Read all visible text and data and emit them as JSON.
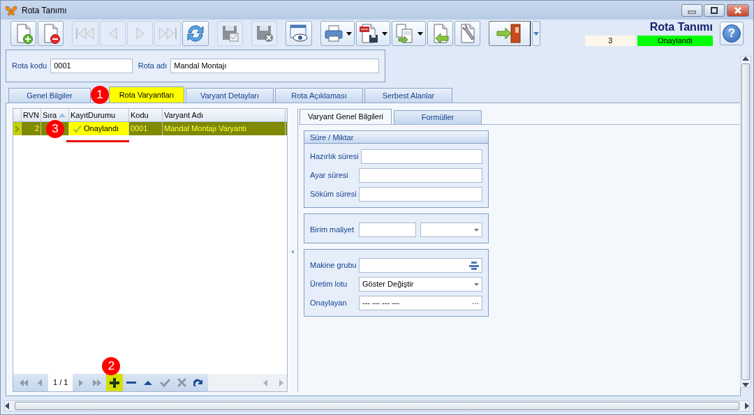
{
  "window": {
    "title": "Rota Tanımı"
  },
  "toolbar": [
    {
      "kind": "new",
      "disabled": false,
      "dropdown": false
    },
    {
      "kind": "delete",
      "disabled": false,
      "dropdown": false
    },
    {
      "kind": "first",
      "disabled": true,
      "dropdown": false
    },
    {
      "kind": "prev",
      "disabled": true,
      "dropdown": false
    },
    {
      "kind": "next",
      "disabled": true,
      "dropdown": false
    },
    {
      "kind": "last",
      "disabled": true,
      "dropdown": false
    },
    {
      "kind": "refresh",
      "disabled": false,
      "dropdown": false
    },
    {
      "kind": "save",
      "disabled": true,
      "dropdown": false
    },
    {
      "kind": "cancel",
      "disabled": true,
      "dropdown": false
    },
    {
      "kind": "preview",
      "disabled": false,
      "dropdown": false
    },
    {
      "kind": "print",
      "disabled": false,
      "dropdown": true
    },
    {
      "kind": "pdf",
      "disabled": false,
      "dropdown": true
    },
    {
      "kind": "copy",
      "disabled": false,
      "dropdown": true
    },
    {
      "kind": "import",
      "disabled": false,
      "dropdown": false
    },
    {
      "kind": "tools",
      "disabled": false,
      "dropdown": false
    },
    {
      "kind": "exit",
      "disabled": false,
      "dropdown": true
    }
  ],
  "header": {
    "title": "Rota Tanımı",
    "record_no": "3",
    "status": "Onaylandı",
    "help": "?"
  },
  "form": [
    {
      "label": "Rota kodu",
      "value": "0001"
    },
    {
      "label": "Rota adı",
      "value": "Mandal Montajı"
    }
  ],
  "tabs": [
    {
      "label": "Genel Bilgiler",
      "selected": false,
      "highlighted": false
    },
    {
      "label": "Rota Varyantları",
      "selected": true,
      "highlighted": true,
      "callout": "1"
    },
    {
      "label": "Varyant Detayları",
      "selected": false,
      "highlighted": false
    },
    {
      "label": "Rota Açıklaması",
      "selected": false,
      "highlighted": false
    },
    {
      "label": "Serbest Alanlar",
      "selected": false,
      "highlighted": false
    }
  ],
  "grid": {
    "columns": [
      "RVN",
      "Sıra",
      "KayıtDurumu",
      "Kodu",
      "Varyant Adı"
    ],
    "rows": [
      {
        "selected": true,
        "callout": "3",
        "cells": [
          "2",
          "",
          "Onaylandı",
          "0001",
          "Mandal Montajı Varyantı"
        ],
        "status_highlighted": true,
        "status_underlined": true
      }
    ]
  },
  "navigator": {
    "page": "1 / 1",
    "buttons": [
      {
        "kind": "first",
        "disabled": true,
        "highlighted": false
      },
      {
        "kind": "prev",
        "disabled": true,
        "highlighted": false
      },
      {
        "kind": "next",
        "disabled": true,
        "highlighted": false
      },
      {
        "kind": "last",
        "disabled": true,
        "highlighted": false
      },
      {
        "kind": "add",
        "disabled": false,
        "highlighted": true,
        "callout": "2"
      },
      {
        "kind": "remove",
        "disabled": false,
        "highlighted": false
      },
      {
        "kind": "up",
        "disabled": false,
        "highlighted": false
      },
      {
        "kind": "accept",
        "disabled": true,
        "highlighted": false
      },
      {
        "kind": "cancel",
        "disabled": true,
        "highlighted": false
      },
      {
        "kind": "redo",
        "disabled": false,
        "highlighted": false
      }
    ]
  },
  "detail_tabs": [
    {
      "label": "Varyant Genel Bilgileri",
      "selected": true
    },
    {
      "label": "Formüller",
      "selected": false
    }
  ],
  "groups": [
    {
      "title": "Süre / Miktar",
      "fields": [
        {
          "label": "Hazırlık süresi",
          "kind": "text"
        },
        {
          "label": "Ayar süresi",
          "kind": "text"
        },
        {
          "label": "Söküm süresi",
          "kind": "text"
        }
      ]
    },
    {
      "fields": [
        {
          "label": "Birim maliyet",
          "kind": "text_combo"
        }
      ]
    },
    {
      "fields": [
        {
          "label": "Makine grubu",
          "kind": "lookup"
        },
        {
          "label": "Üretim lotu",
          "kind": "combo",
          "value": "Göster Değiştir"
        },
        {
          "label": "Onaylayan",
          "kind": "ellipsis",
          "value": "--- --- --- ---"
        }
      ]
    }
  ]
}
